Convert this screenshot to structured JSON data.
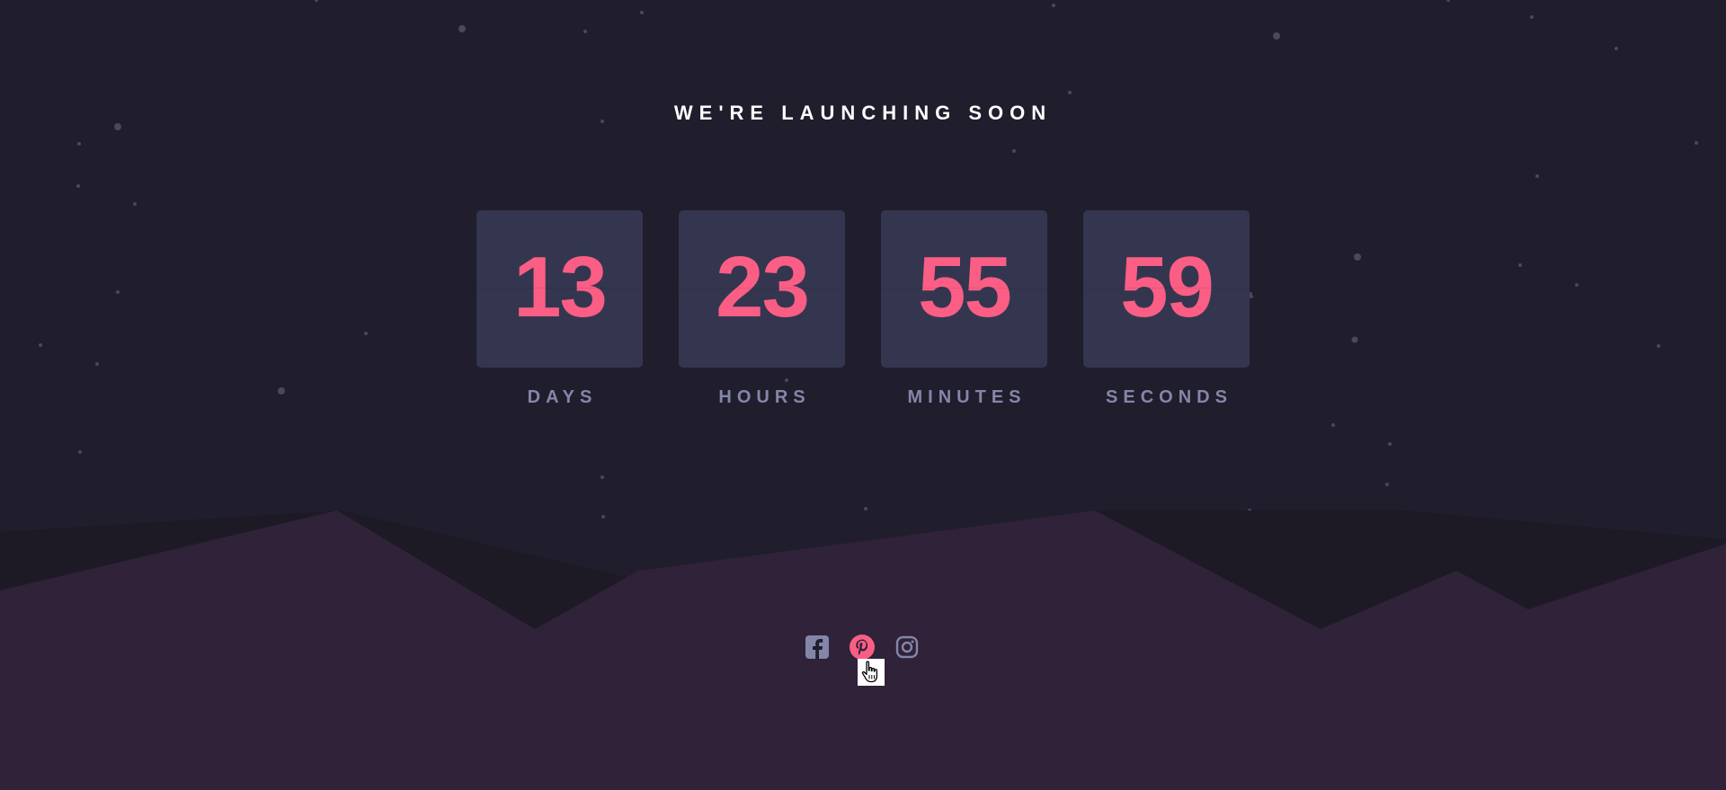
{
  "page": {
    "title": "WE'RE LAUNCHING SOON"
  },
  "countdown": [
    {
      "value": "13",
      "label": "DAYS"
    },
    {
      "value": "23",
      "label": "HOURS"
    },
    {
      "value": "55",
      "label": "MINUTES"
    },
    {
      "value": "59",
      "label": "SECONDS"
    }
  ],
  "social": [
    {
      "icon": "facebook-icon",
      "state": "default"
    },
    {
      "icon": "pinterest-icon",
      "state": "hover"
    },
    {
      "icon": "instagram-icon",
      "state": "default"
    }
  ],
  "colors": {
    "background": "#201d2c",
    "hills_back": "#1d1a26",
    "hills_front": "#2f2239",
    "card": "#343650",
    "accent": "#fb5e84",
    "label": "#8486a9",
    "icon_default": "#8486a9",
    "icon_hover": "#fb5e84"
  }
}
